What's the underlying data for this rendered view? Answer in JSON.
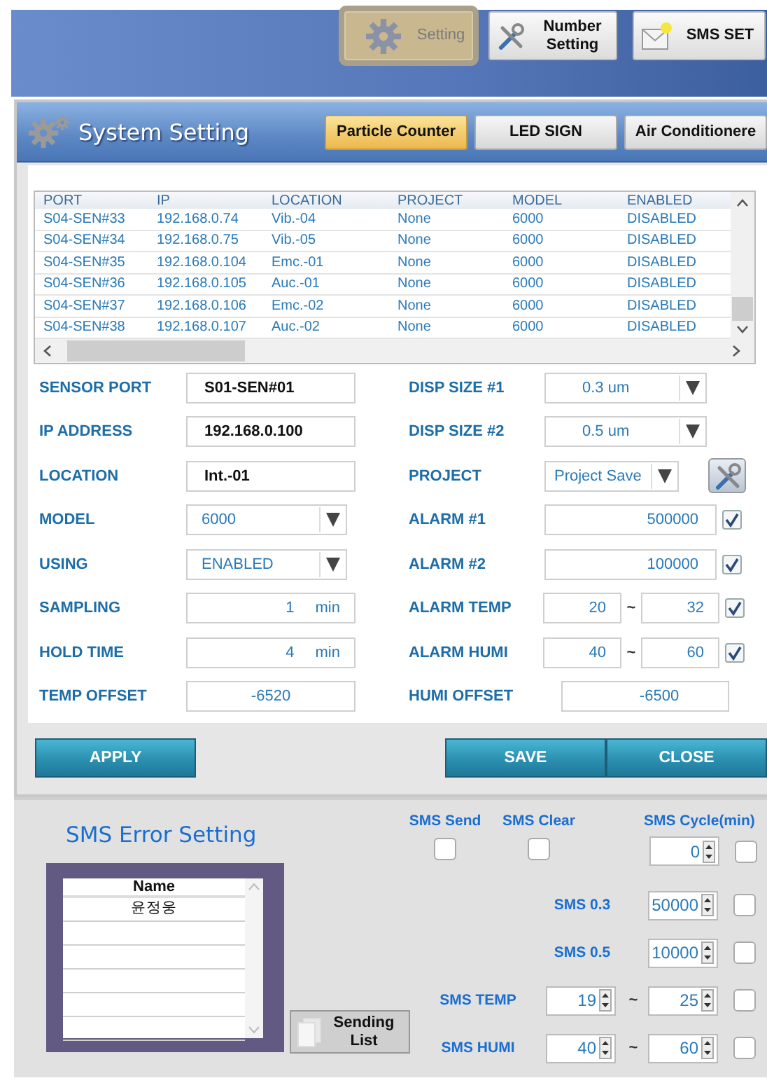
{
  "top_bar": {
    "buttons": [
      {
        "label": "Setting",
        "selected": true
      },
      {
        "label": "Number Setting",
        "selected": false
      },
      {
        "label": "SMS SET",
        "selected": false
      }
    ]
  },
  "dialog": {
    "title": "System Setting",
    "tabs": [
      {
        "label": "Particle Counter",
        "selected": true
      },
      {
        "label": "LED SIGN",
        "selected": false
      },
      {
        "label": "Air Conditionere",
        "selected": false
      }
    ]
  },
  "sensor_table": {
    "columns": [
      "PORT",
      "IP",
      "LOCATION",
      "PROJECT",
      "MODEL",
      "ENABLED"
    ],
    "rows": [
      [
        "S04-SEN#33",
        "192.168.0.74",
        "Vib.-04",
        "None",
        "6000",
        "DISABLED"
      ],
      [
        "S04-SEN#34",
        "192.168.0.75",
        "Vib.-05",
        "None",
        "6000",
        "DISABLED"
      ],
      [
        "S04-SEN#35",
        "192.168.0.104",
        "Emc.-01",
        "None",
        "6000",
        "DISABLED"
      ],
      [
        "S04-SEN#36",
        "192.168.0.105",
        "Auc.-01",
        "None",
        "6000",
        "DISABLED"
      ],
      [
        "S04-SEN#37",
        "192.168.0.106",
        "Emc.-02",
        "None",
        "6000",
        "DISABLED"
      ],
      [
        "S04-SEN#38",
        "192.168.0.107",
        "Auc.-02",
        "None",
        "6000",
        "DISABLED"
      ]
    ]
  },
  "form": {
    "left": [
      {
        "label": "SENSOR PORT",
        "kind": "text",
        "value": "S01-SEN#01"
      },
      {
        "label": "IP ADDRESS",
        "kind": "text",
        "value": "192.168.0.100"
      },
      {
        "label": "LOCATION",
        "kind": "text",
        "value": "Int.-01"
      },
      {
        "label": "MODEL",
        "kind": "select",
        "value": "6000"
      },
      {
        "label": "USING",
        "kind": "select",
        "value": "ENABLED"
      },
      {
        "label": "SAMPLING",
        "kind": "number",
        "value": "1",
        "unit": "min"
      },
      {
        "label": "HOLD TIME",
        "kind": "number",
        "value": "4",
        "unit": "min"
      },
      {
        "label": "TEMP OFFSET",
        "kind": "number",
        "value": "-6520"
      }
    ],
    "right": [
      {
        "label": "DISP SIZE #1",
        "kind": "select",
        "value": "0.3 um"
      },
      {
        "label": "DISP SIZE #2",
        "kind": "select",
        "value": "0.5 um"
      },
      {
        "label": "PROJECT",
        "kind": "select_tool",
        "value": "Project Save"
      },
      {
        "label": "ALARM #1",
        "kind": "check_number",
        "value": "500000",
        "checked": true
      },
      {
        "label": "ALARM #2",
        "kind": "check_number",
        "value": "100000",
        "checked": true
      },
      {
        "label": "ALARM TEMP",
        "kind": "check_range",
        "value": "20",
        "separator": "~",
        "value2": "32",
        "checked": true
      },
      {
        "label": "ALARM HUMI",
        "kind": "check_range",
        "value": "40",
        "separator": "~",
        "value2": "60",
        "checked": true
      },
      {
        "label": "HUMI OFFSET",
        "kind": "number",
        "value": "-6500"
      }
    ]
  },
  "actions": {
    "apply": "APPLY",
    "save": "SAVE",
    "close": "CLOSE"
  },
  "sms": {
    "title": "SMS Error Setting",
    "name_list": {
      "column": "Name",
      "rows": [
        "윤정웅"
      ]
    },
    "sending_button": "Sending List",
    "send": {
      "label": "SMS Send",
      "checked": false
    },
    "clear": {
      "label": "SMS Clear",
      "checked": false
    },
    "cycle": {
      "label": "SMS Cycle(min)",
      "value": "0",
      "checked": false
    },
    "rows": [
      {
        "label": "SMS 0.3",
        "kind": "single",
        "value": "50000",
        "checked": false
      },
      {
        "label": "SMS 0.5",
        "kind": "single",
        "value": "10000",
        "checked": false
      },
      {
        "label": "SMS TEMP",
        "kind": "range",
        "value": "19",
        "separator": "~",
        "value2": "25",
        "checked": false
      },
      {
        "label": "SMS HUMI",
        "kind": "range",
        "value": "40",
        "separator": "~",
        "value2": "60",
        "checked": false
      }
    ]
  }
}
